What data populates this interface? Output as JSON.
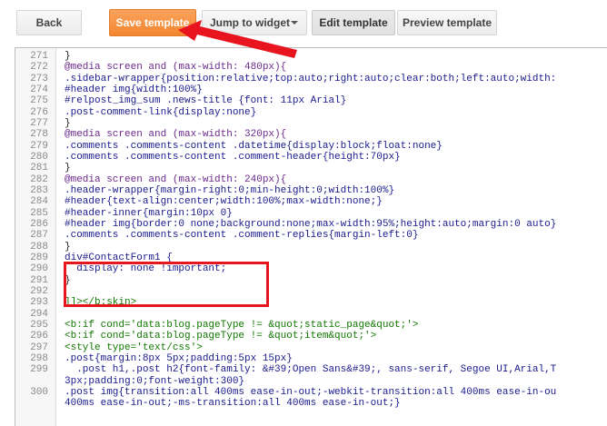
{
  "toolbar": {
    "back": "Back",
    "save": "Save template",
    "jump": "Jump to widget",
    "edit": "Edit template",
    "preview": "Preview template"
  },
  "editor": {
    "lines": [
      {
        "n": "271",
        "text": "}",
        "cls": "g"
      },
      {
        "n": "272",
        "text": "@media screen and (max-width: 480px){",
        "cls": "m"
      },
      {
        "n": "273",
        "text": ".sidebar-wrapper{position:relative;top:auto;right:auto;clear:both;left:auto;width:",
        "cls": ""
      },
      {
        "n": "274",
        "text": "#header img{width:100%}",
        "cls": ""
      },
      {
        "n": "275",
        "text": "#relpost_img_sum .news-title {font: 11px Arial}",
        "cls": ""
      },
      {
        "n": "276",
        "text": ".post-comment-link{display:none}",
        "cls": ""
      },
      {
        "n": "277",
        "text": "}",
        "cls": "g"
      },
      {
        "n": "278",
        "text": "@media screen and (max-width: 320px){",
        "cls": "m"
      },
      {
        "n": "279",
        "text": ".comments .comments-content .datetime{display:block;float:none}",
        "cls": ""
      },
      {
        "n": "280",
        "text": ".comments .comments-content .comment-header{height:70px}",
        "cls": ""
      },
      {
        "n": "281",
        "text": "}",
        "cls": "g"
      },
      {
        "n": "282",
        "text": "@media screen and (max-width: 240px){",
        "cls": "m"
      },
      {
        "n": "283",
        "text": ".header-wrapper{margin-right:0;min-height:0;width:100%}",
        "cls": ""
      },
      {
        "n": "284",
        "text": "#header{text-align:center;width:100%;max-width:none;}",
        "cls": ""
      },
      {
        "n": "285",
        "text": "#header-inner{margin:10px 0}",
        "cls": ""
      },
      {
        "n": "286",
        "text": "#header img{border:0 none;background:none;max-width:95%;height:auto;margin:0 auto}",
        "cls": ""
      },
      {
        "n": "287",
        "text": ".comments .comments-content .comment-replies{margin-left:0}",
        "cls": ""
      },
      {
        "n": "288",
        "text": "}",
        "cls": "g"
      },
      {
        "n": "289",
        "text": "div#ContactForm1 {",
        "cls": ""
      },
      {
        "n": "290",
        "text": "  display: none !important;",
        "cls": ""
      },
      {
        "n": "291",
        "text": "}",
        "cls": "g"
      },
      {
        "n": "292",
        "text": "",
        "cls": ""
      },
      {
        "n": "293",
        "text": "]]></b:skin>",
        "cls": "t"
      },
      {
        "n": "294",
        "text": "",
        "cls": ""
      },
      {
        "n": "295",
        "text": "<b:if cond='data:blog.pageType != &quot;static_page&quot;'>",
        "cls": "t"
      },
      {
        "n": "296",
        "text": "<b:if cond='data:blog.pageType != &quot;item&quot;'>",
        "cls": "t"
      },
      {
        "n": "297",
        "text": "<style type='text/css'>",
        "cls": "t"
      },
      {
        "n": "298",
        "text": ".post{margin:8px 5px;padding:5px 15px}",
        "cls": ""
      },
      {
        "n": "299",
        "text": "  .post h1,.post h2{font-family: &#39;Open Sans&#39;, sans-serif, Segoe UI,Arial,T",
        "cls": ""
      },
      {
        "n": "",
        "text": "3px;padding:0;font-weight:300}",
        "cls": ""
      },
      {
        "n": "300",
        "text": ".post img{transition:all 400ms ease-in-out;-webkit-transition:all 400ms ease-in-ou",
        "cls": ""
      },
      {
        "n": "",
        "text": "400ms ease-in-out;-ms-transition:all 400ms ease-in-out;}",
        "cls": ""
      }
    ]
  }
}
